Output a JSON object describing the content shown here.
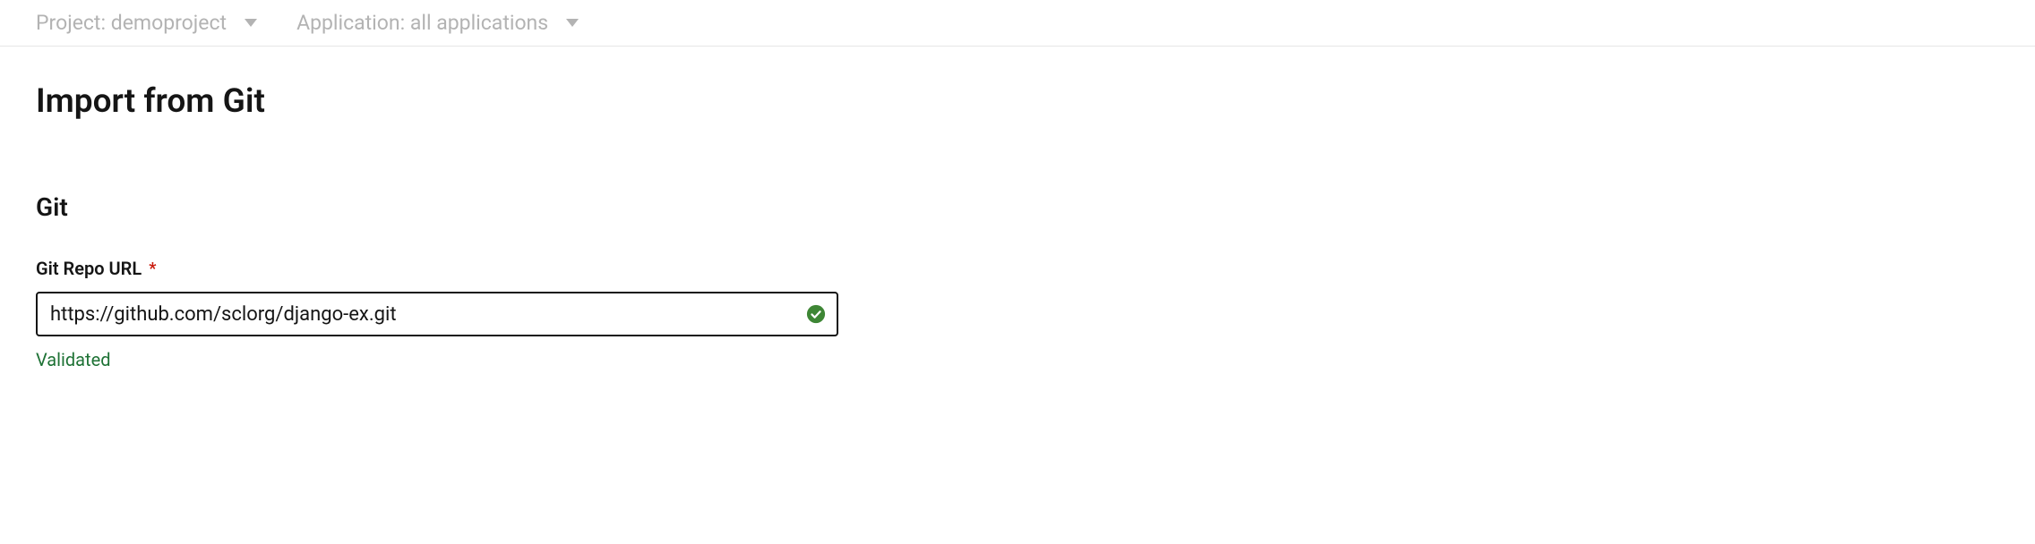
{
  "topbar": {
    "project_label": "Project: demoproject",
    "application_label": "Application: all applications"
  },
  "page": {
    "title": "Import from Git"
  },
  "git_section": {
    "heading": "Git",
    "repo_url_label": "Git Repo URL",
    "required_mark": "*",
    "repo_url_value": "https://github.com/sclorg/django-ex.git",
    "status_text": "Validated"
  }
}
